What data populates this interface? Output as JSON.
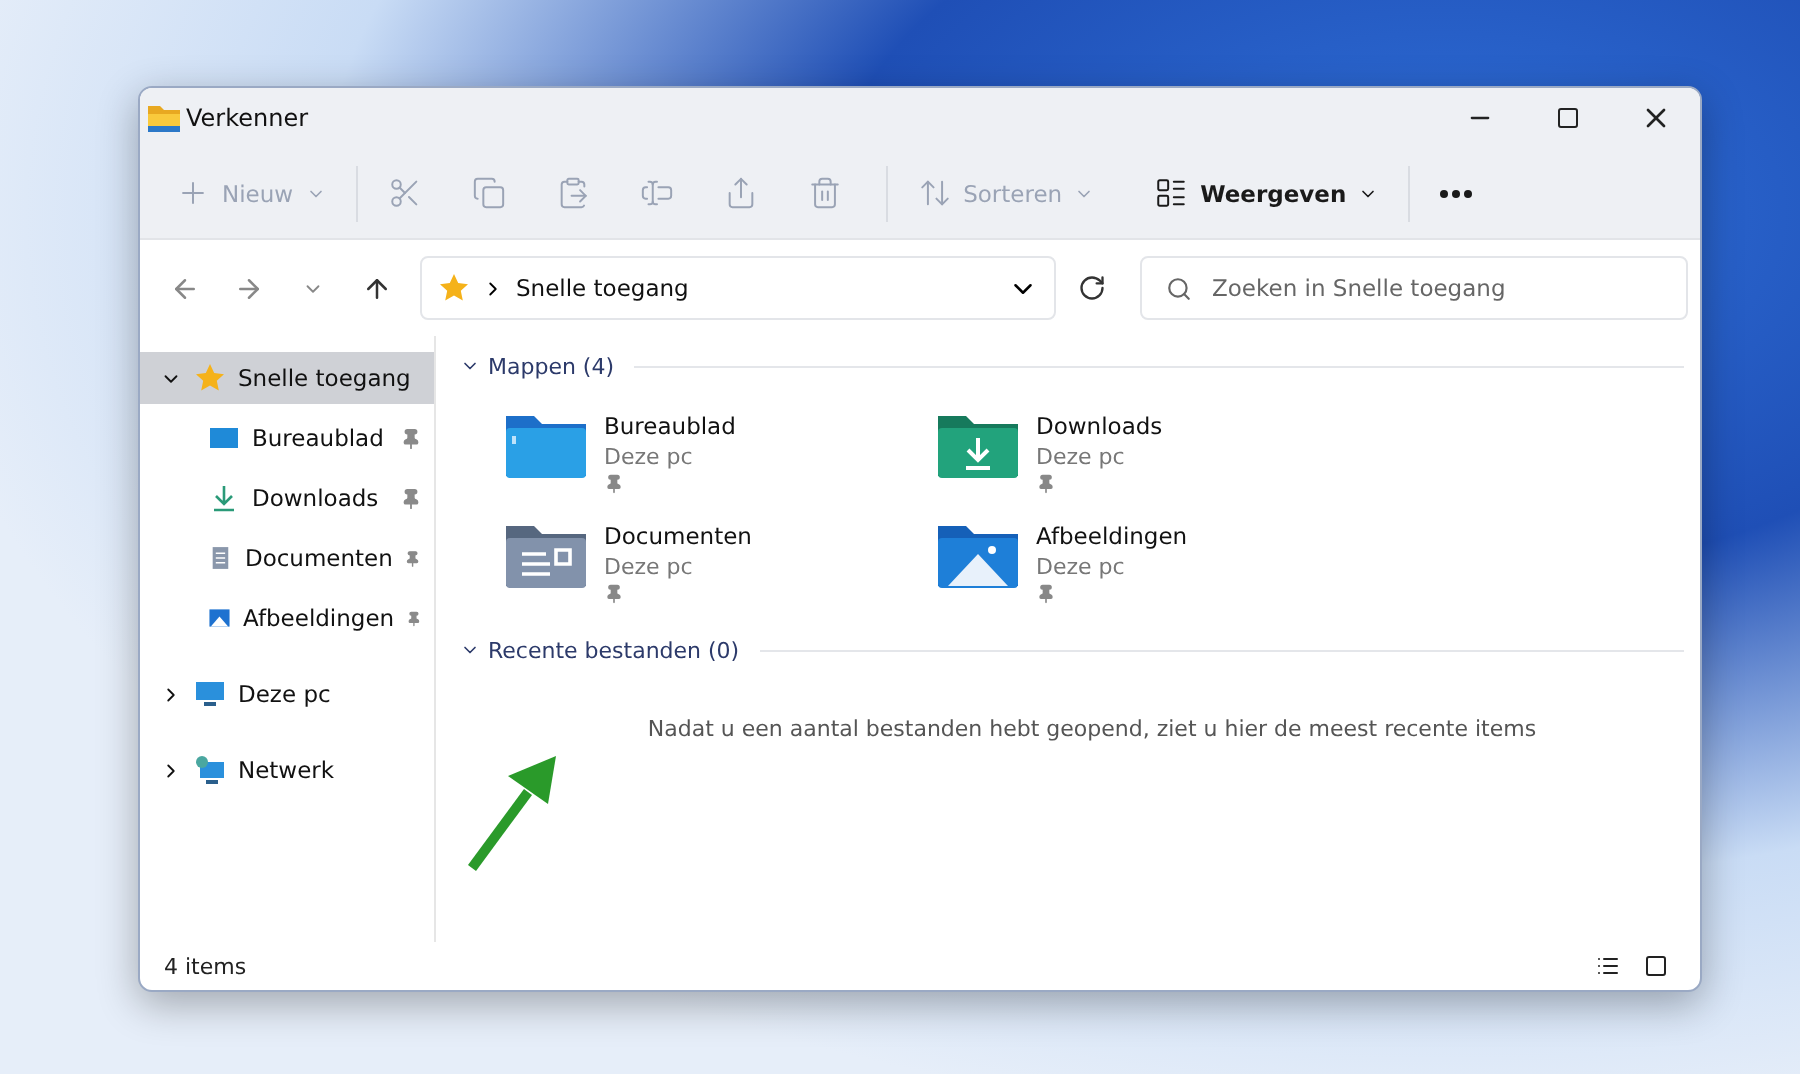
{
  "window": {
    "title": "Verkenner"
  },
  "toolbar": [
    {
      "kind": "new",
      "label": "Nieuw",
      "disabled": true
    },
    {
      "kind": "cut",
      "disabled": true
    },
    {
      "kind": "copy",
      "disabled": true
    },
    {
      "kind": "paste",
      "disabled": true
    },
    {
      "kind": "rename",
      "disabled": true
    },
    {
      "kind": "share",
      "disabled": true
    },
    {
      "kind": "delete",
      "disabled": true
    },
    {
      "kind": "sort",
      "label": "Sorteren",
      "disabled": true
    },
    {
      "kind": "view",
      "label": "Weergeven",
      "disabled": false
    },
    {
      "kind": "more",
      "disabled": false
    }
  ],
  "address": {
    "path": "Snelle toegang"
  },
  "search": {
    "placeholder": "Zoeken in Snelle toegang"
  },
  "sidebar": {
    "items": [
      {
        "kind": "star",
        "label": "Snelle toegang",
        "selected": true,
        "expanded": true,
        "children": [
          {
            "kind": "desktop",
            "label": "Bureaublad",
            "selected": false,
            "pinned": true
          },
          {
            "kind": "download",
            "label": "Downloads",
            "selected": false,
            "pinned": true
          },
          {
            "kind": "document",
            "label": "Documenten",
            "selected": false,
            "pinned": true
          },
          {
            "kind": "picture",
            "label": "Afbeeldingen",
            "selected": false,
            "pinned": true
          }
        ]
      },
      {
        "kind": "pc",
        "label": "Deze pc",
        "selected": false,
        "expanded": false
      },
      {
        "kind": "network",
        "label": "Netwerk",
        "selected": false,
        "expanded": false
      }
    ]
  },
  "folders": {
    "title": "Mappen (4)",
    "items": [
      {
        "kind": "desktop",
        "name": "Bureaublad",
        "location": "Deze pc",
        "pinned": true
      },
      {
        "kind": "download",
        "name": "Downloads",
        "location": "Deze pc",
        "pinned": true
      },
      {
        "kind": "document",
        "name": "Documenten",
        "location": "Deze pc",
        "pinned": true
      },
      {
        "kind": "picture",
        "name": "Afbeeldingen",
        "location": "Deze pc",
        "pinned": true
      }
    ]
  },
  "recent": {
    "title": "Recente bestanden (0)",
    "empty_message": "Nadat u een aantal bestanden hebt geopend, ziet u hier de meest recente items"
  },
  "status_bar": {
    "count": "4 items"
  }
}
